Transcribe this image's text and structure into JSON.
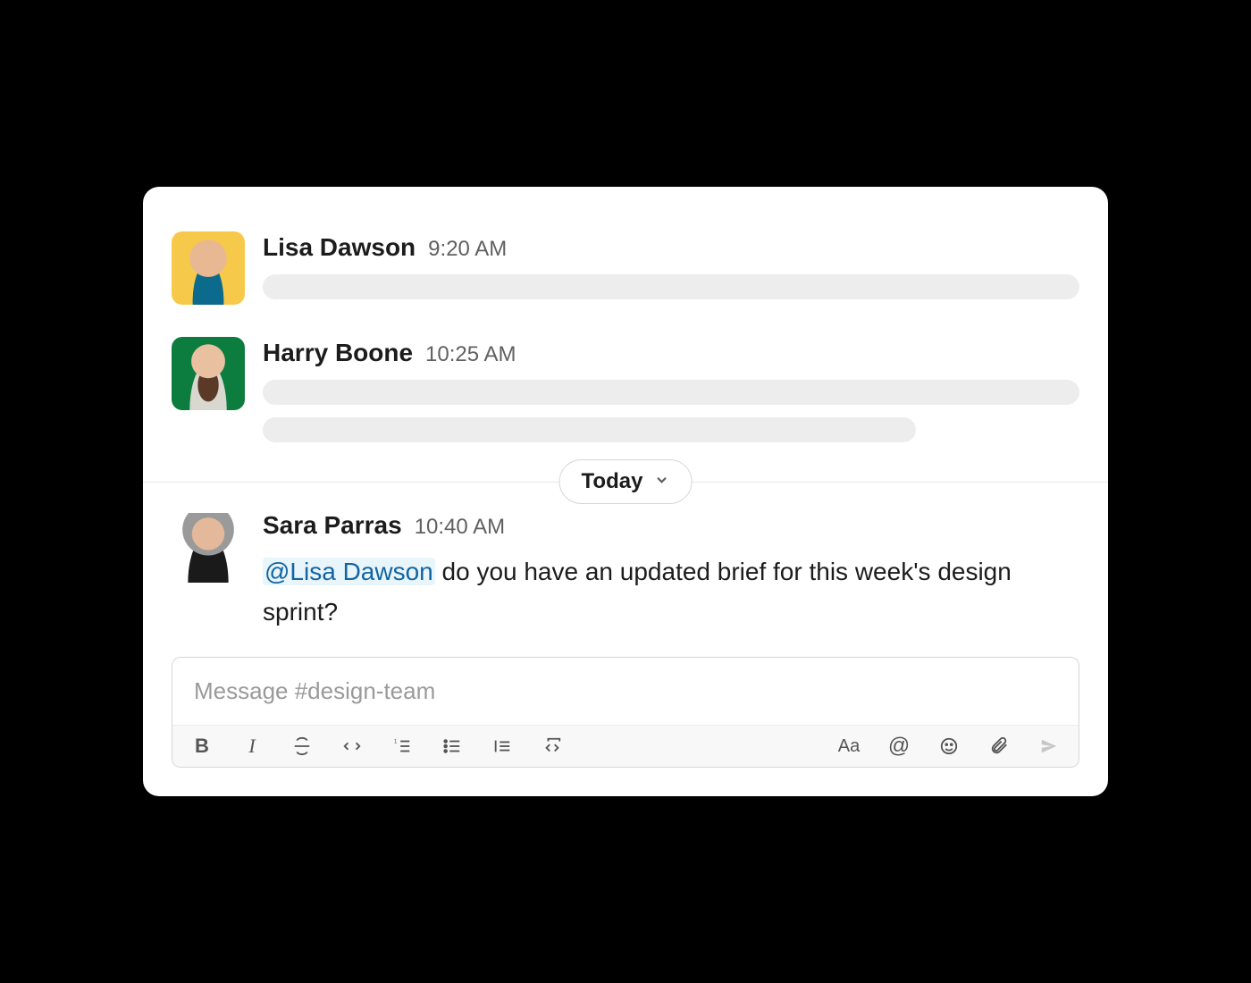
{
  "messages": [
    {
      "author": "Lisa Dawson",
      "time": "9:20 AM",
      "placeholder_lines": 1
    },
    {
      "author": "Harry Boone",
      "time": "10:25 AM",
      "placeholder_lines": 2
    }
  ],
  "divider": {
    "label": "Today"
  },
  "message_today": {
    "author": "Sara Parras",
    "time": "10:40 AM",
    "mention": "@Lisa Dawson",
    "text_after_mention": " do you have an updated brief for this week's design sprint?"
  },
  "composer": {
    "placeholder": "Message #design-team"
  },
  "toolbar": {
    "bold": "B",
    "italic": "I",
    "font": "Aa",
    "at": "@"
  }
}
